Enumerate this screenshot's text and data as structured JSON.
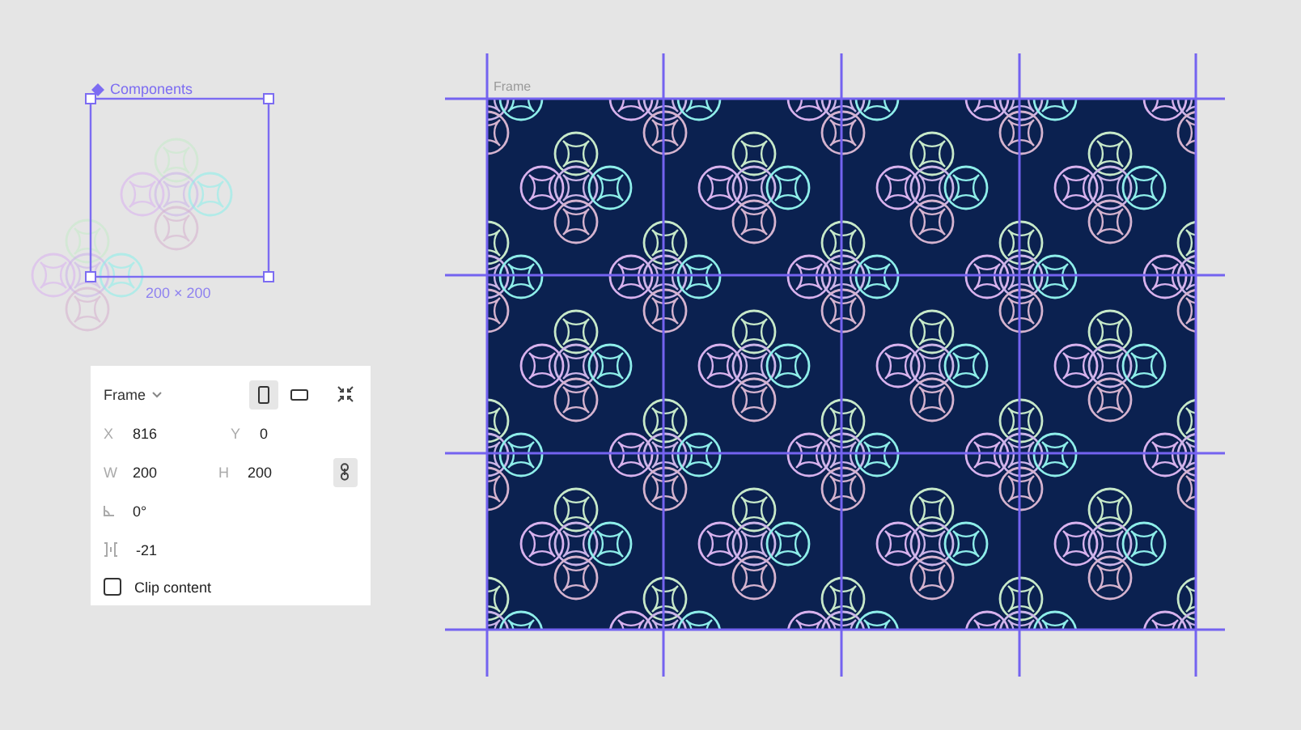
{
  "component_set": {
    "label": "Components",
    "size": "200 × 200"
  },
  "properties": {
    "title": "Frame",
    "orientation": [
      {
        "kind": "portrait",
        "selected": true
      },
      {
        "kind": "landscape",
        "selected": false
      }
    ],
    "rows": [
      {
        "kind": "pair",
        "fields": [
          {
            "label": "X",
            "value": "816"
          },
          {
            "label": "Y",
            "value": "0"
          }
        ]
      },
      {
        "kind": "pair",
        "fields": [
          {
            "label": "W",
            "value": "200"
          },
          {
            "label": "H",
            "value": "200"
          }
        ],
        "constrain_proportions": true
      },
      {
        "kind": "rotation",
        "value": "0°"
      },
      {
        "kind": "spacing",
        "value": "-21"
      }
    ],
    "clip_content": {
      "label": "Clip content",
      "checked": false
    }
  },
  "frame": {
    "label": "Frame"
  }
}
